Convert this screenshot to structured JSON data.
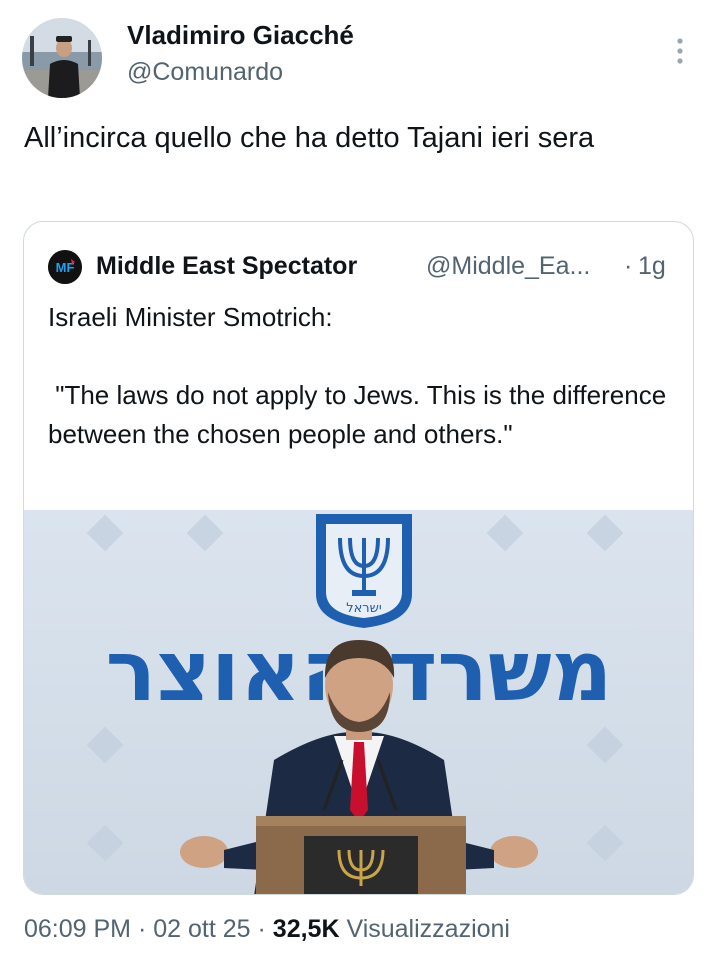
{
  "author": {
    "name": "Vladimiro Giacché",
    "handle": "@Comunardo"
  },
  "tweet": {
    "text": "All’incirca quello che ha detto Tajani ieri sera"
  },
  "quoted": {
    "avatar_label": "MF",
    "name": "Middle East Spectator",
    "handle": "@Middle_Ea...",
    "separator": "·",
    "time": "1g",
    "text": "Israeli Minister Smotrich:\n\n \"The laws do not apply to Jews. This is the difference between the chosen people and others.\"",
    "image": {
      "banner_text": "משרד האוצר",
      "emblem_text": "ישראל"
    }
  },
  "footer": {
    "time": "06:09 PM",
    "sep1": "·",
    "date": "02 ott 25",
    "sep2": "·",
    "views_count": "32,5K",
    "views_label": "Visualizzazioni"
  },
  "colors": {
    "text_primary": "#0f1419",
    "text_secondary": "#536471",
    "border": "#cfd9de",
    "emblem_blue": "#1f5fb0",
    "tie_red": "#c8102e"
  },
  "icons": [
    "more-vertical-icon"
  ]
}
